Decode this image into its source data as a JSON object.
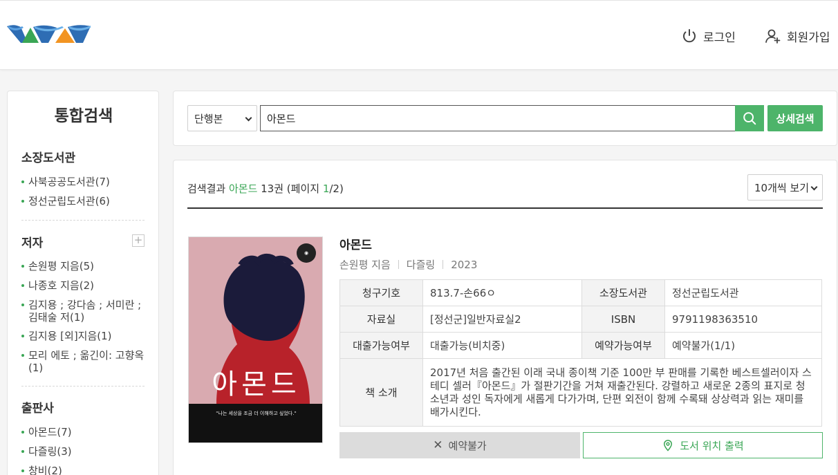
{
  "header": {
    "login_label": "로그인",
    "signup_label": "회원가입"
  },
  "sidebar": {
    "title": "통합검색",
    "sections": [
      {
        "title": "소장도서관",
        "items": [
          "사북공공도서관(7)",
          "정선군립도서관(6)"
        ]
      },
      {
        "title": "저자",
        "items": [
          "손원평 지음(5)",
          "나종호 지음(2)",
          "김지용 ; 강다솜 ; 서미란 ; 김태술 저(1)",
          "김지용 [외]지음(1)",
          "모리 에토 ; 옮긴이: 고향옥(1)"
        ]
      },
      {
        "title": "출판사",
        "items": [
          "아몬드(7)",
          "다즐링(3)",
          "창비(2)"
        ]
      }
    ]
  },
  "search": {
    "type_value": "단행본",
    "query": "아몬드",
    "advanced_label": "상세검색"
  },
  "results": {
    "summary_prefix": "검색결과 ",
    "keyword": "아몬드",
    "count_text": " 13권 (페이지 ",
    "page_current": "1",
    "page_total": "/2)",
    "per_page": "10개씩 보기"
  },
  "book": {
    "title": "아몬드",
    "author": "손원평 지음",
    "publisher": "다즐링",
    "year": "2023",
    "cover_title": "아몬드",
    "cover_quote": "\"나는 세상을 조금 더 이해하고 싶었다.\"",
    "fields": {
      "call_no_label": "청구기호",
      "call_no": "813.7-손66ㅇ",
      "library_label": "소장도서관",
      "library": "정선군립도서관",
      "room_label": "자료실",
      "room": "[정선군]일반자료실2",
      "isbn_label": "ISBN",
      "isbn": "9791198363510",
      "loan_label": "대출가능여부",
      "loan": "대출가능(비치중)",
      "reserve_label": "예약가능여부",
      "reserve": "예약불가(1/1)",
      "intro_label": "책 소개",
      "intro": "2017년 처음 출간된 이래 국내 종이책 기준 100만 부 판매를 기록한 베스트셀러이자 스테디 셀러『아몬드』가 절판기간을 거쳐 재출간된다. 강렬하고 새로운 2종의 표지로 청소년과 성인 독자에게 새롭게 다가가며, 단편 외전이 함께 수록돼 상상력과 읽는 재미를 배가시킨다."
    },
    "reserve_button": "예약불가",
    "location_button": "도서 위치 출력"
  },
  "colors": {
    "accent": "#4db46a",
    "loan_blue": "#2a5aa8",
    "reserve_red": "#c0282e"
  }
}
